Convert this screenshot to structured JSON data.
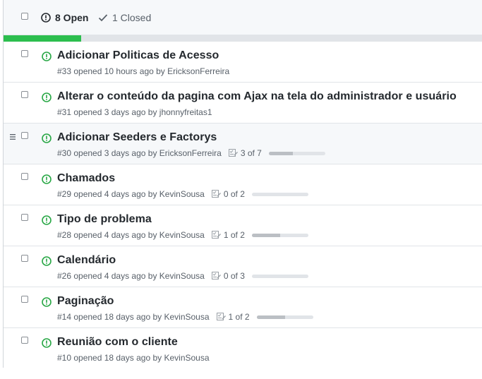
{
  "header": {
    "open_label": "8 Open",
    "closed_label": "1 Closed",
    "progress_fraction": 0.16
  },
  "issues": [
    {
      "title": "Adicionar Politicas de Acesso",
      "meta": "#33 opened 10 hours ago by ",
      "author": "EricksonFerreira",
      "tasks": null
    },
    {
      "title": "Alterar o conteúdo da pagina com Ajax na tela do administrador e usuário",
      "meta": "#31 opened 3 days ago by ",
      "author": "jhonnyfreitas1",
      "tasks": null
    },
    {
      "title": "Adicionar Seeders e Factorys",
      "meta": "#30 opened 3 days ago by ",
      "author": "EricksonFerreira",
      "tasks": {
        "label": "3 of 7",
        "done": 3,
        "total": 7
      }
    },
    {
      "title": "Chamados",
      "meta": "#29 opened 4 days ago by ",
      "author": "KevinSousa",
      "tasks": {
        "label": "0 of 2",
        "done": 0,
        "total": 2
      }
    },
    {
      "title": "Tipo de problema",
      "meta": "#28 opened 4 days ago by ",
      "author": "KevinSousa",
      "tasks": {
        "label": "1 of 2",
        "done": 1,
        "total": 2
      }
    },
    {
      "title": "Calendário",
      "meta": "#26 opened 4 days ago by ",
      "author": "KevinSousa",
      "tasks": {
        "label": "0 of 3",
        "done": 0,
        "total": 3
      }
    },
    {
      "title": "Paginação",
      "meta": "#14 opened 18 days ago by ",
      "author": "KevinSousa",
      "tasks": {
        "label": "1 of 2",
        "done": 1,
        "total": 2
      }
    },
    {
      "title": "Reunião com o cliente",
      "meta": "#10 opened 18 days ago by ",
      "author": "KevinSousa",
      "tasks": null
    }
  ],
  "colors": {
    "open_green": "#28a745",
    "progress_green": "#2cbe4e"
  },
  "icons": {
    "open": "issue-opened-icon",
    "closed": "check-icon",
    "tasks": "checklist-icon",
    "drag": "drag-handle-icon"
  }
}
